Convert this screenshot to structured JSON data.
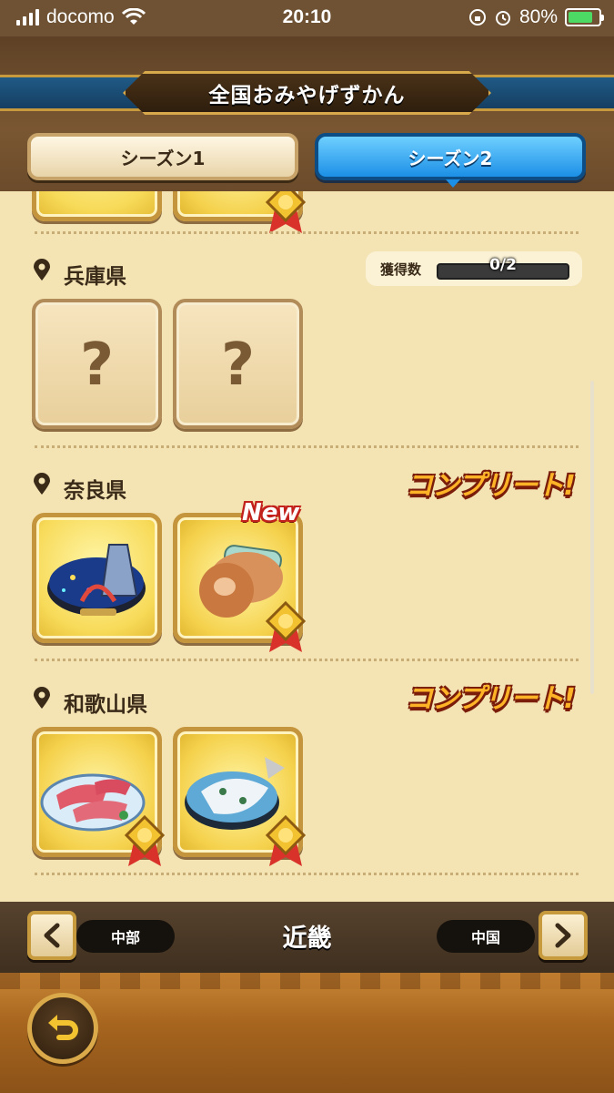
{
  "status_bar": {
    "carrier": "docomo",
    "time": "20:10",
    "battery": "80%"
  },
  "header": {
    "title": "全国おみやげずかん"
  },
  "tabs": [
    {
      "label": "シーズン1",
      "selected": false
    },
    {
      "label": "シーズン2",
      "selected": true
    }
  ],
  "prefectures": [
    {
      "name": "兵庫県",
      "count_label": "獲得数",
      "count_text": "0/2",
      "progress": 0,
      "items": [
        "?",
        "?"
      ]
    },
    {
      "name": "奈良県",
      "status": "コンプリート!",
      "new_label": "New"
    },
    {
      "name": "和歌山県",
      "status": "コンプリート!"
    }
  ],
  "nav": {
    "prev": "中部",
    "current": "近畿",
    "next": "中国"
  },
  "colors": {
    "tab_active": "#1c8fe6",
    "complete_text": "#ffb428",
    "content_bg": "#f4e3b3"
  },
  "icons": [
    "wifi-icon",
    "battery-icon",
    "location-pin-icon",
    "medal-icon",
    "back-arrow-icon"
  ]
}
